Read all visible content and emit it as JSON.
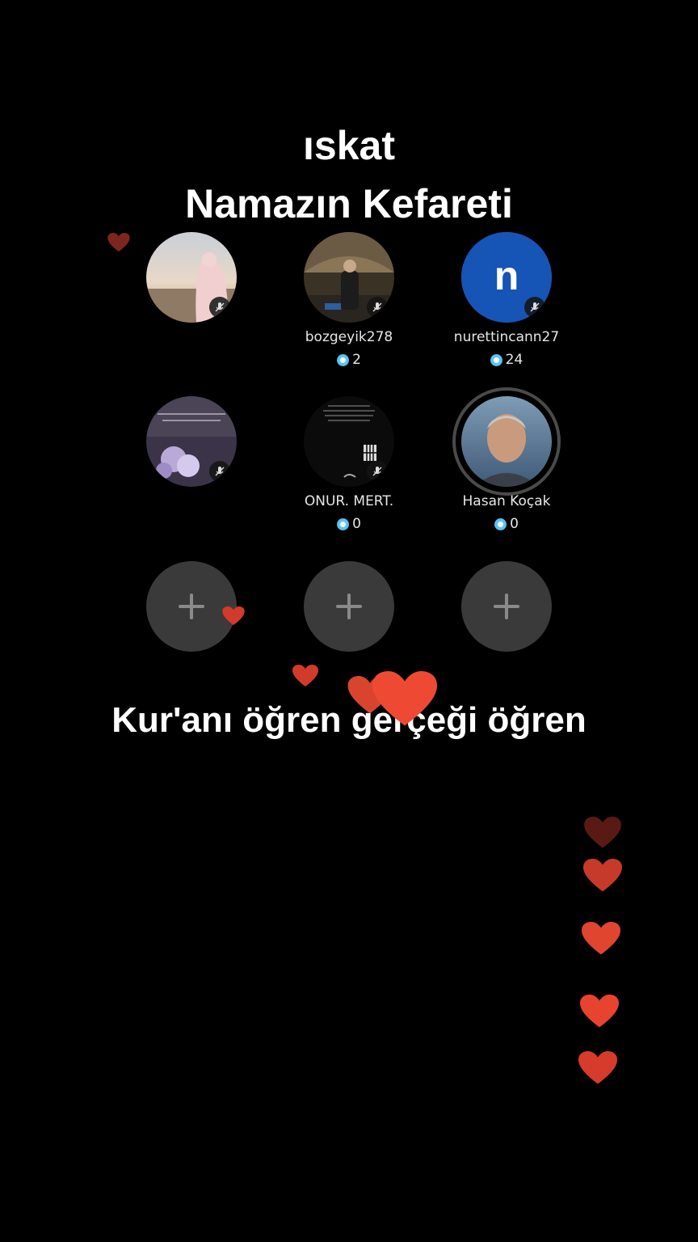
{
  "title": {
    "line1": "ıskat",
    "line2": "Namazın Kefareti"
  },
  "seats": [
    {
      "username": "",
      "score": "",
      "avatar": "photo-woman-beach",
      "muted": true
    },
    {
      "username": "bozgeyik278",
      "score": "2",
      "avatar": "photo-man-mosque",
      "muted": true
    },
    {
      "username": "nurettincann27",
      "score": "24",
      "avatar": "letter",
      "avatar_letter": "n",
      "avatar_color": "#1655b5",
      "muted": true
    },
    {
      "username": "",
      "score": "",
      "avatar": "photo-flowers-text",
      "muted": true
    },
    {
      "username": "ONUR. MERT.",
      "score": "0",
      "avatar": "photo-dark-text",
      "muted": true
    },
    {
      "username": "Hasan Koçak",
      "score": "0",
      "avatar": "photo-man-portrait",
      "muted": false,
      "speaking": true
    }
  ],
  "empty_seats": [
    {
      "icon": "plus-icon"
    },
    {
      "icon": "plus-icon"
    },
    {
      "icon": "plus-icon"
    }
  ],
  "caption": "Kur'anı öğren gerçeği öğren",
  "colors": {
    "background": "#000000",
    "heart": "#e8432f",
    "empty_seat": "#3a3a3a",
    "gem": "#5ec2e8"
  }
}
